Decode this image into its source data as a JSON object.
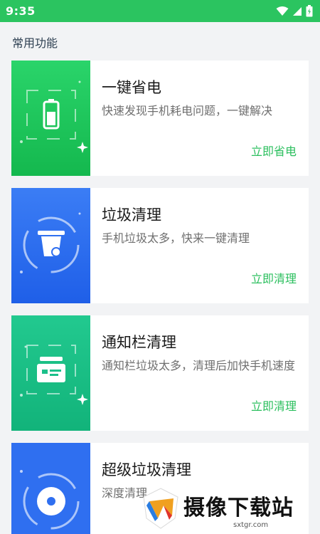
{
  "status_bar": {
    "time": "9:35"
  },
  "section": {
    "title": "常用功能"
  },
  "cards": [
    {
      "title": "一键省电",
      "desc": "快速发现手机耗电问题，一键解决",
      "action": "立即省电"
    },
    {
      "title": "垃圾清理",
      "desc": "手机垃圾太多，快来一键清理",
      "action": "立即清理"
    },
    {
      "title": "通知栏清理",
      "desc": "通知栏垃圾太多，清理后加快手机速度",
      "action": "立即清理"
    },
    {
      "title": "超级垃圾清理",
      "desc": "深度清理",
      "action": ""
    }
  ],
  "watermark": {
    "brand": "摄像下载站",
    "url": "sxtgr.com"
  },
  "colors": {
    "status_bar": "#2bc460",
    "action_text": "#2bbf5e",
    "green_card": "#22c05a",
    "blue_card": "#2f6ff0",
    "teal_card": "#1cc08a"
  }
}
